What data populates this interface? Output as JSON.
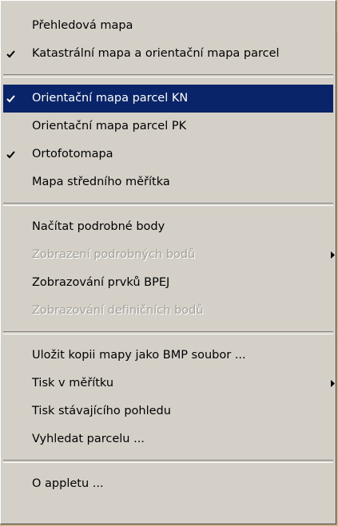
{
  "menu": {
    "groups": [
      {
        "items": [
          {
            "label": "Přehledová mapa",
            "checked": false
          },
          {
            "label": "Katastrální mapa a orientační mapa parcel",
            "checked": true
          }
        ]
      },
      {
        "items": [
          {
            "label": "Orientační mapa parcel KN",
            "checked": true,
            "selected": true
          },
          {
            "label": "Orientační mapa parcel PK",
            "checked": false
          },
          {
            "label": "Ortofotomapa",
            "checked": true
          },
          {
            "label": "Mapa středního měřítka",
            "checked": false
          }
        ]
      },
      {
        "items": [
          {
            "label": "Načítat podrobné body",
            "checked": false
          },
          {
            "label": "Zobrazení podrobných bodů",
            "checked": false,
            "disabled": true,
            "submenu": true
          },
          {
            "label": "Zobrazování prvků BPEJ",
            "checked": false
          },
          {
            "label": "Zobrazování definičních bodů",
            "checked": false,
            "disabled": true
          }
        ]
      },
      {
        "items": [
          {
            "label": "Uložit kopii mapy jako BMP soubor ...",
            "checked": false
          },
          {
            "label": "Tisk v měřítku",
            "checked": false,
            "submenu": true
          },
          {
            "label": "Tisk stávajícího pohledu",
            "checked": false
          },
          {
            "label": "Vyhledat parcelu ...",
            "checked": false
          }
        ]
      },
      {
        "items": [
          {
            "label": "O appletu ...",
            "checked": false
          }
        ]
      }
    ],
    "icons": {
      "check": "checkmark-icon",
      "submenu": "submenu-arrow-icon"
    },
    "colors": {
      "menu_bg": "#d4d0c8",
      "selected_bg": "#0a246a",
      "selected_text": "#ffffff",
      "disabled_text": "#a4a09a"
    }
  }
}
